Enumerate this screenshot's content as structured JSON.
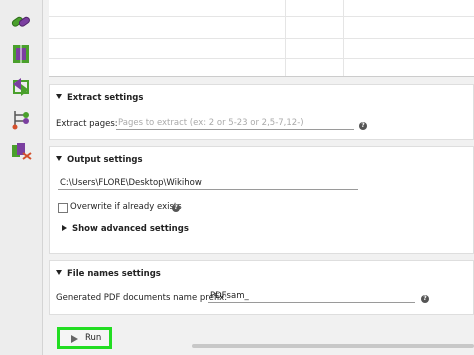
{
  "sidebar": {
    "tools": [
      {
        "name": "merge-icon"
      },
      {
        "name": "split-icon"
      },
      {
        "name": "rotate-icon"
      },
      {
        "name": "split-by-bookmarks-icon"
      },
      {
        "name": "extract-icon"
      }
    ]
  },
  "extract": {
    "header": "Extract settings",
    "pages_label": "Extract pages:",
    "pages_placeholder": "Pages to extract (ex: 2 or 5-23 or 2,5-7,12-)"
  },
  "output": {
    "header": "Output settings",
    "path_value": "C:\\Users\\FLORE\\Desktop\\Wikihow",
    "overwrite_label": "Overwrite if already exists",
    "overwrite_checked": false,
    "advanced_label": "Show advanced settings"
  },
  "filenames": {
    "header": "File names settings",
    "prefix_label": "Generated PDF documents name prefix:",
    "prefix_value": "PDFsam_"
  },
  "run": {
    "label": "Run"
  },
  "colors": {
    "run_highlight": "#22dd22",
    "accent_green": "#4aa02c",
    "accent_purple": "#7b3fa0"
  }
}
